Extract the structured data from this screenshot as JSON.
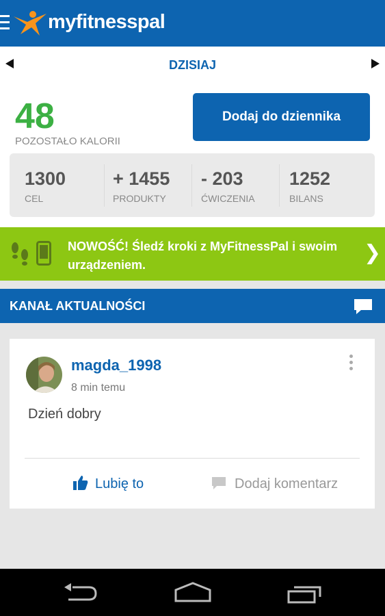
{
  "header": {
    "app_name": "myfitnesspal"
  },
  "date_nav": {
    "label": "DZISIAJ"
  },
  "summary": {
    "remaining_value": "48",
    "remaining_label": "POZOSTAŁO KALORII",
    "add_button_label": "Dodaj do dziennika",
    "stats": [
      {
        "value": "1300",
        "label": "CEL"
      },
      {
        "value": "+ 1455",
        "label": "PRODUKTY"
      },
      {
        "value": "- 203",
        "label": "ĆWICZENIA"
      },
      {
        "value": "1252",
        "label": "BILANS"
      }
    ]
  },
  "promo": {
    "text": "NOWOŚĆ! Śledź kroki z MyFitnessPal i swoim urządzeniem.",
    "chevron": "❯"
  },
  "feed": {
    "title": "KANAŁ AKTUALNOŚCI",
    "post": {
      "username": "magda_1998",
      "time": "8 min temu",
      "text": "Dzień dobry",
      "like_label": "Lubię to",
      "comment_label": "Dodaj komentarz"
    }
  },
  "colors": {
    "brand_blue": "#0d64b0",
    "calories_green": "#3cb043",
    "promo_green": "#8dc713"
  },
  "icons": [
    "menu-icon",
    "logo-figure-icon",
    "chevron-left-icon",
    "chevron-right-icon",
    "footsteps-icon",
    "device-icon",
    "chat-icon",
    "more-vertical-icon",
    "thumbs-up-icon",
    "comment-icon",
    "back-icon",
    "home-icon",
    "recent-apps-icon"
  ]
}
